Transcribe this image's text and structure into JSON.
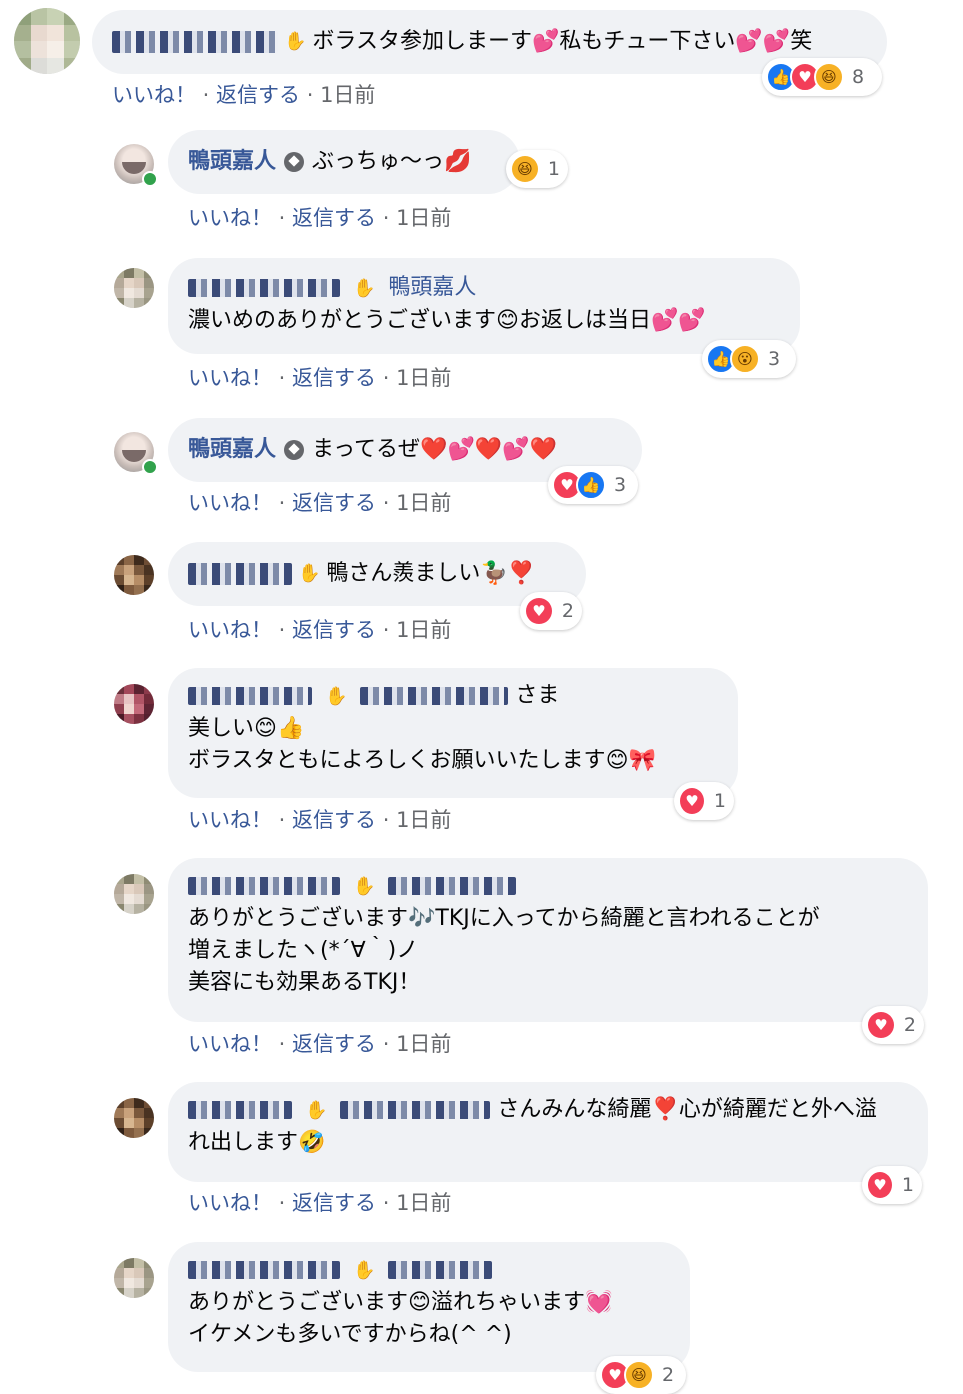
{
  "colors": {
    "bubble": "#f0f2f5",
    "link": "#385898",
    "meta": "#65676b",
    "like": "#1877f2",
    "love": "#f33e58",
    "haha": "#f7b125"
  },
  "icons": {
    "wave": "waving-hand-icon",
    "page_badge": "shield-badge-icon",
    "like": "like-icon",
    "love": "love-icon",
    "haha": "haha-icon",
    "wow": "wow-icon"
  },
  "actions": {
    "like": "いいね！",
    "sep": " · ",
    "reply": "返信する",
    "time": "1日前"
  },
  "comments": [
    {
      "text": "ボラスタ参加しまーす",
      "hearts1": "💕",
      "text2": "私もチュー下さい",
      "hearts2": "💕💕",
      "text3": "笑",
      "reactions": {
        "count": "8"
      }
    },
    {
      "author": "鴨頭嘉人",
      "text": "ぶっちゅ〜っ",
      "emoji": "💋",
      "reactions": {
        "count": "1"
      }
    },
    {
      "reply_to": "鴨頭嘉人",
      "text": "濃いめのありがとうございます",
      "emoji1": "😊",
      "text2": "お返しは当日",
      "emoji2": "💕💕",
      "reactions": {
        "count": "3"
      }
    },
    {
      "author": "鴨頭嘉人",
      "text": "まってるぜ",
      "emoji": "❤️💕❤️💕❤️",
      "reactions": {
        "count": "3"
      }
    },
    {
      "text": "鴨さん羨ましい",
      "emoji": "🦆❣️",
      "reactions": {
        "count": "2"
      }
    },
    {
      "suffix": "さま",
      "line1": "美しい",
      "line1_emoji": "😊👍",
      "line2": "ボラスタともによろしくお願いいたします",
      "line2_emoji": "😊🎀",
      "reactions": {
        "count": "1"
      }
    },
    {
      "line1": "ありがとうございます",
      "line1_emoji": "🎶",
      "line1b": "TKJに入ってから綺麗と言われることが",
      "line2": "増えましたヽ(*´∀｀)ノ",
      "line3": "美容にも効果あるTKJ！",
      "reactions": {
        "count": "2"
      }
    },
    {
      "line1": "さんみんな綺麗",
      "line1_emoji": "❣️",
      "line1b": "心が綺麗だと外へ溢",
      "line2": "れ出します",
      "line2_emoji": "🤣",
      "reactions": {
        "count": "1"
      }
    },
    {
      "line1": "ありがとうございます",
      "line1_emoji": "😊",
      "line1b": "溢れちゃいます",
      "line1b_emoji": "💓",
      "line2": "イケメンも多いですからね(^ ^)",
      "reactions": {
        "count": "2"
      }
    }
  ]
}
